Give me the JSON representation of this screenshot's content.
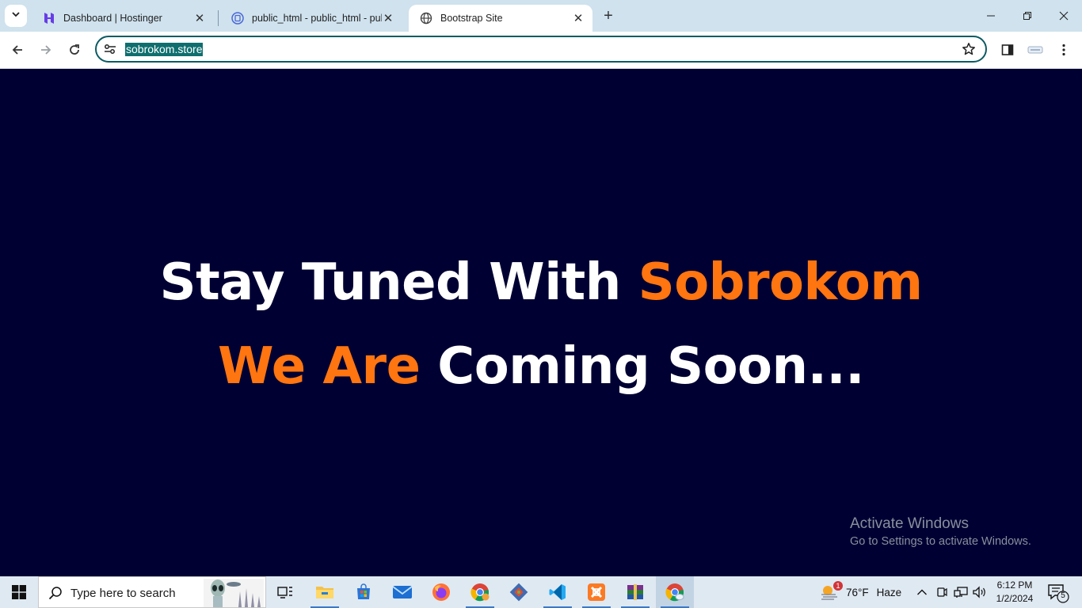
{
  "browser": {
    "tabs": [
      {
        "title": "Dashboard | Hostinger",
        "icon": "hostinger-icon",
        "active": false
      },
      {
        "title": "public_html - public_html - pub",
        "icon": "file-manager-icon",
        "active": false
      },
      {
        "title": "Bootstrap Site",
        "icon": "globe-icon",
        "active": true
      }
    ],
    "url": "sobrokom.store"
  },
  "page": {
    "line1_white": "Stay Tuned With ",
    "line1_accent": "Sobrokom",
    "line2_accent": "We Are",
    "line2_white": " Coming Soon...",
    "accent_color": "#ff7510",
    "background_color": "#000033"
  },
  "watermark": {
    "title": "Activate Windows",
    "subtitle": "Go to Settings to activate Windows."
  },
  "taskbar": {
    "search_placeholder": "Type here to search",
    "apps": [
      "task-view",
      "file-explorer",
      "microsoft-store",
      "mail",
      "firefox",
      "chrome",
      "git",
      "vs-code",
      "xampp",
      "winrar",
      "chrome-active"
    ],
    "weather": {
      "badge": "1",
      "temp": "76°F",
      "condition": "Haze"
    },
    "time": "6:12 PM",
    "date": "1/2/2024",
    "notification_count": "5"
  }
}
